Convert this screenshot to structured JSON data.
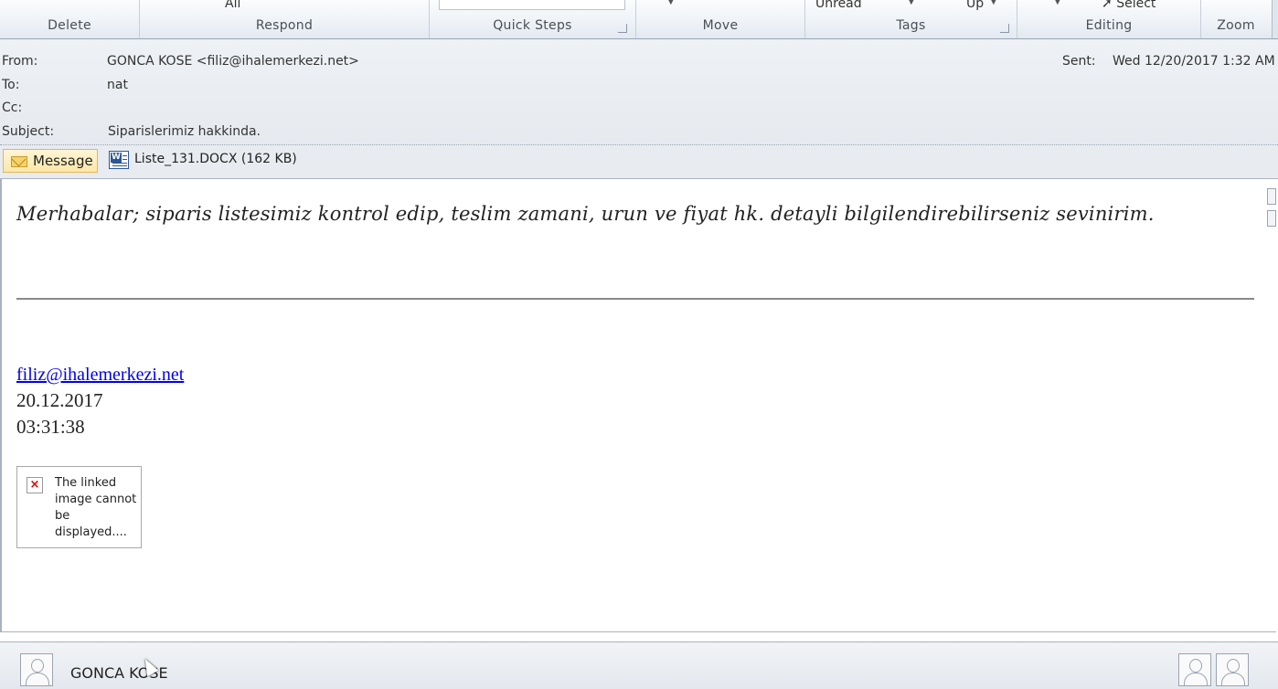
{
  "ribbon": {
    "groups": {
      "delete": "Delete",
      "respond": "Respond",
      "quick_steps": "Quick Steps",
      "move": "Move",
      "tags": "Tags",
      "editing": "Editing",
      "zoom": "Zoom"
    },
    "partial_top": {
      "all": "All",
      "unread": "Unread",
      "up": "Up",
      "select": "Select"
    }
  },
  "header": {
    "from_label": "From:",
    "from_value": "GONCA KOSE <filiz@ihalemerkezi.net>",
    "to_label": "To:",
    "to_value": "nat",
    "cc_label": "Cc:",
    "cc_value": "",
    "subject_label": "Subject:",
    "subject_value": "Siparislerimiz hakkinda.",
    "sent_label": "Sent:",
    "sent_value": "Wed 12/20/2017 1:32 AM"
  },
  "tabs": {
    "message": "Message",
    "attachment": "Liste_131.DOCX (162 KB)"
  },
  "body": {
    "greeting": "Merhabalar; siparis listesimiz kontrol edip, teslim zamani, urun ve  fiyat hk. detayli bilgilendirebilirseniz sevinirim.",
    "email_link": "filiz@ihalemerkezi.net",
    "date": "20.12.2017",
    "time": "03:31:38",
    "broken_image_text": "The linked image cannot be displayed...."
  },
  "people_pane": {
    "name": "GONCA KOSE"
  },
  "colors": {
    "link": "#0000ee",
    "header_bg": "#e8ecf1",
    "message_tab": "#fde7a6"
  }
}
